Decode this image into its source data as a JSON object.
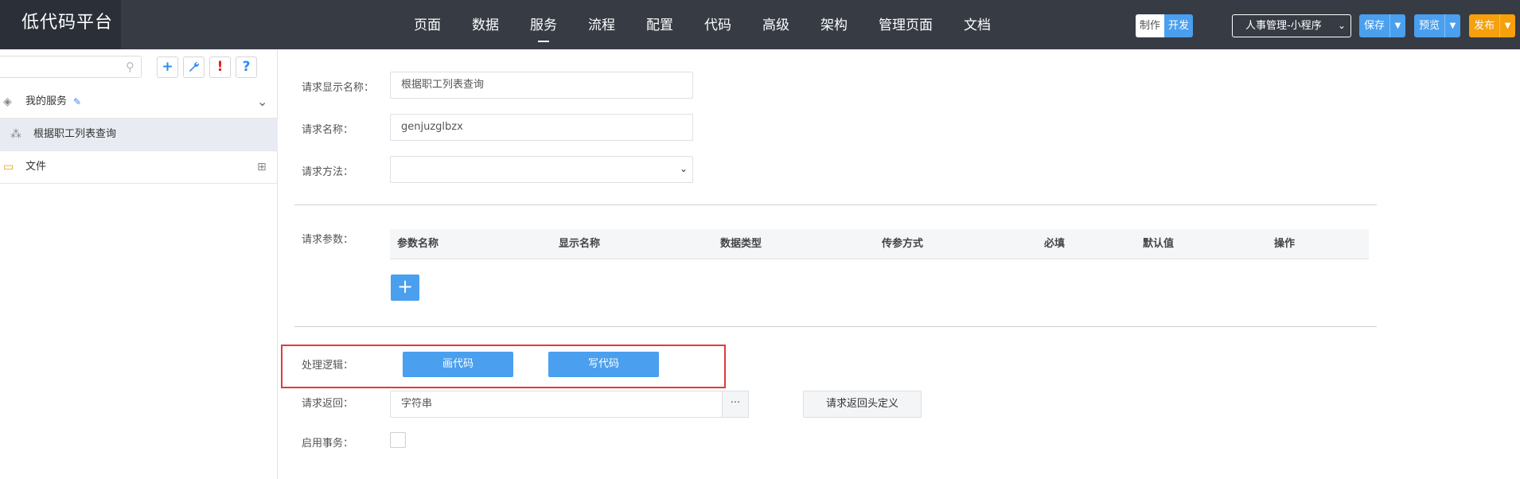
{
  "app": {
    "title": "低代码平台"
  },
  "nav": {
    "items": [
      "页面",
      "数据",
      "服务",
      "流程",
      "配置",
      "代码",
      "高级",
      "架构",
      "管理页面",
      "文档"
    ],
    "active": "服务"
  },
  "mode_toggle": {
    "make": "制作",
    "dev": "开发"
  },
  "project_select": {
    "value": "人事管理-小程序"
  },
  "actions": {
    "save": "保存",
    "preview": "预览",
    "publish": "发布"
  },
  "sidebar": {
    "search_icon": "search-icon",
    "tools": [
      {
        "glyph": "+",
        "name": "add-icon",
        "color": "#2d8cf0"
      },
      {
        "glyph": "🔧",
        "name": "wrench-icon",
        "color": "#2d8cf0"
      },
      {
        "glyph": "!",
        "name": "alert-icon",
        "color": "#e02020"
      },
      {
        "glyph": "?",
        "name": "help-icon",
        "color": "#2d8cf0"
      }
    ],
    "group": {
      "label": "我的服务",
      "edit_icon": "pencil-icon",
      "collapse_icon": "chevron-down-icon"
    },
    "items": [
      {
        "label": "根据职工列表查询",
        "icon": "service-icon"
      }
    ],
    "folder": {
      "label": "文件",
      "icon": "folder-icon",
      "grid_icon": "grid-icon"
    }
  },
  "form": {
    "display_name_label": "请求显示名称：",
    "display_name_value": "根据职工列表查询",
    "name_label": "请求名称：",
    "name_value": "genjuzglbzx",
    "method_label": "请求方法：",
    "method_value": "",
    "params_label": "请求参数：",
    "params_columns": [
      "参数名称",
      "显示名称",
      "数据类型",
      "传参方式",
      "必填",
      "默认值",
      "操作"
    ],
    "add_param": "+",
    "logic_label": "处理逻辑：",
    "draw_code": "画代码",
    "write_code": "写代码",
    "return_label": "请求返回：",
    "return_value": "字符串",
    "return_more": "···",
    "return_header_btn": "请求返回头定义",
    "transaction_label": "启用事务："
  },
  "colors": {
    "topbar": "#363b44",
    "accent": "#4a9fee",
    "publish": "#f6a00c",
    "highlight_box": "#e03a3a"
  }
}
